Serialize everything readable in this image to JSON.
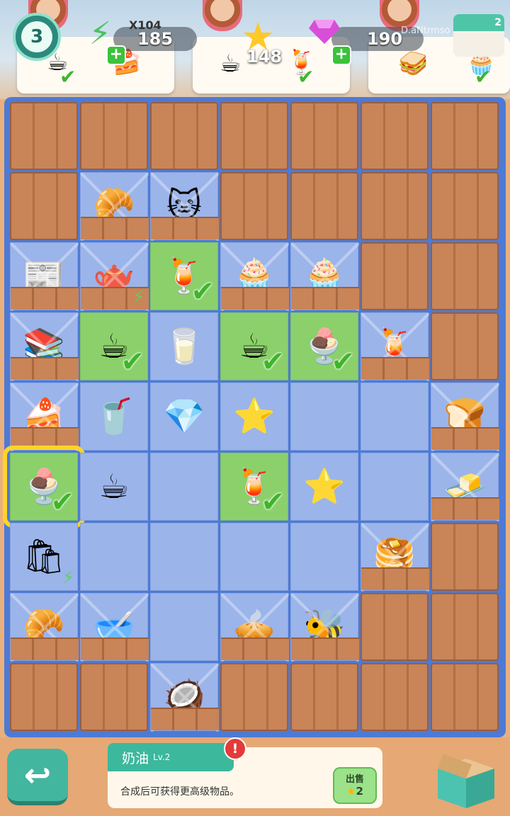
{
  "header": {
    "level": "3",
    "energy": "185",
    "energy_multiplier": "X104",
    "stars": "148",
    "gems": "190",
    "player_tag": "D.aNtrmso",
    "shop_badge": "2"
  },
  "orders": [
    {
      "items": [
        "coffee",
        "cake-slice"
      ],
      "checks": [
        true,
        false
      ]
    },
    {
      "items": [
        "latte",
        "blue-drink"
      ],
      "checks": [
        false,
        true
      ]
    },
    {
      "items": [
        "sandwich",
        "cupcake"
      ],
      "checks": [
        false,
        true
      ]
    }
  ],
  "colors": {
    "board_border": "#4d7ad6",
    "empty_cell": "#9bb4ea",
    "ready_cell": "#8bd06b",
    "locked_crate": "#c98457",
    "selection": "#ffd42a",
    "accent": "#43b6a0"
  },
  "board": {
    "rows": 9,
    "cols": 7,
    "cells": [
      [
        "L",
        "L",
        "L",
        "L",
        "L",
        "L",
        "L"
      ],
      [
        "L",
        "W:bread-basket",
        "W:cat",
        "L",
        "L",
        "L",
        "L"
      ],
      [
        "W:newspaper",
        "W:tea-set",
        "G:blue-drink",
        "W:cupcake",
        "W:muffin",
        "L",
        "L"
      ],
      [
        "W:books",
        "G:coffee",
        "E:milk",
        "G:coffee",
        "G:cream-cup",
        "W:blue-drink",
        "L"
      ],
      [
        "W:cake",
        "E:coffee-cup",
        "E:gem",
        "E:stars",
        "E",
        "E",
        "W:toaster"
      ],
      [
        "S:cream-cup",
        "E:espresso",
        "E",
        "G:blue-drink",
        "E:stars",
        "E",
        "W:butter"
      ],
      [
        "E:shopping-bag",
        "E",
        "E",
        "E",
        "E",
        "W:pancakes",
        "L"
      ],
      [
        "W:bread-basket",
        "W:bowl",
        "E",
        "W:pie",
        "W:bee",
        "L",
        "L"
      ],
      [
        "L",
        "L",
        "W:coconut",
        "L",
        "L",
        "L",
        "L"
      ]
    ]
  },
  "footer": {
    "item_name": "奶油",
    "item_level": "Lv.2",
    "description": "合成后可获得更高级物品。",
    "sell_label": "出售",
    "sell_price": "2"
  }
}
